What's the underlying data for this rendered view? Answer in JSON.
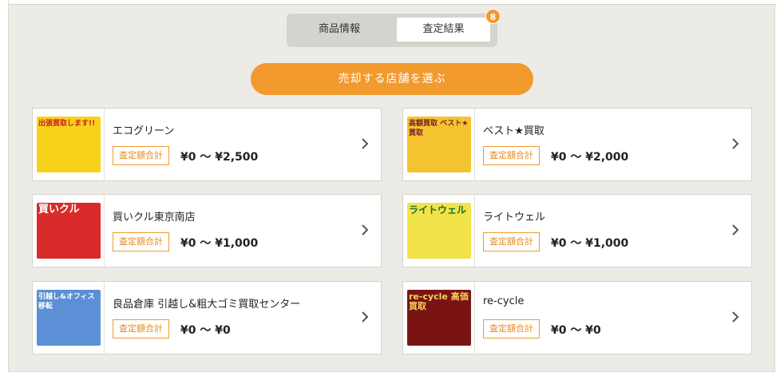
{
  "tabs": {
    "info_label": "商品情報",
    "result_label": "査定結果",
    "result_badge": "8"
  },
  "cta_label": "売却する店舗を選ぶ",
  "stores": [
    {
      "name": "エコグリーン",
      "pill": "査定額合計",
      "range": "¥0 〜 ¥2,500",
      "thumb_text": "出張買取します!!",
      "thumb_bg": "#f7d21b",
      "thumb_fg": "#c81e1e"
    },
    {
      "name": "ベスト★買取",
      "pill": "査定額合計",
      "range": "¥0 〜 ¥2,000",
      "thumb_text": "高額買取 ベスト★買取",
      "thumb_bg": "#f4c430",
      "thumb_fg": "#7a1d1d"
    },
    {
      "name": "買いクル東京南店",
      "pill": "査定額合計",
      "range": "¥0 〜 ¥1,000",
      "thumb_text": "買いクル",
      "thumb_bg": "#d92b2b",
      "thumb_fg": "#ffffff"
    },
    {
      "name": "ライトウェル",
      "pill": "査定額合計",
      "range": "¥0 〜 ¥1,000",
      "thumb_text": "ライトウェル",
      "thumb_bg": "#f2e34a",
      "thumb_fg": "#1d6e2c"
    },
    {
      "name": "良品倉庫 引越し&粗大ゴミ買取センター",
      "pill": "査定額合計",
      "range": "¥0 〜 ¥0",
      "thumb_text": "引越し&オフィス移転",
      "thumb_bg": "#5b8fd6",
      "thumb_fg": "#ffffff"
    },
    {
      "name": "re-cycle",
      "pill": "査定額合計",
      "range": "¥0 〜 ¥0",
      "thumb_text": "re-cycle 高価買取",
      "thumb_bg": "#7a1414",
      "thumb_fg": "#f5d25a"
    }
  ],
  "colors": {
    "accent": "#f29a2e",
    "panel_bg": "#ecebe6"
  }
}
